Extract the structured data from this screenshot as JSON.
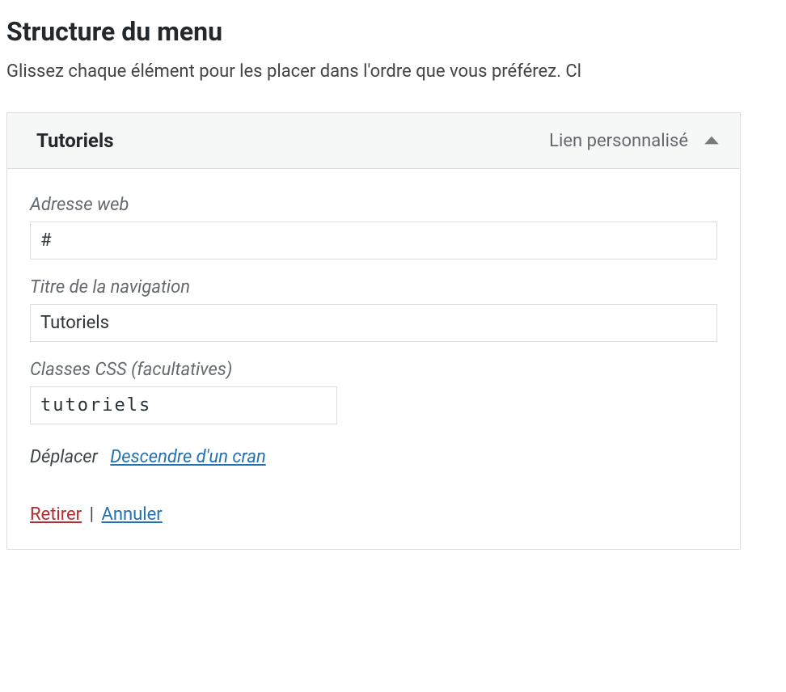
{
  "section": {
    "title": "Structure du menu",
    "description": "Glissez chaque élément pour les placer dans l'ordre que vous préférez. Cl"
  },
  "menu_item": {
    "title": "Tutoriels",
    "type_label": "Lien personnalisé",
    "fields": {
      "url_label": "Adresse web",
      "url_value": "#",
      "nav_label": "Titre de la navigation",
      "nav_value": "Tutoriels",
      "css_label": "Classes CSS (facultatives)",
      "css_value": "tutoriels"
    },
    "move": {
      "label": "Déplacer",
      "down_one": "Descendre d'un cran"
    },
    "actions": {
      "remove": "Retirer",
      "separator": "|",
      "cancel": "Annuler"
    }
  }
}
